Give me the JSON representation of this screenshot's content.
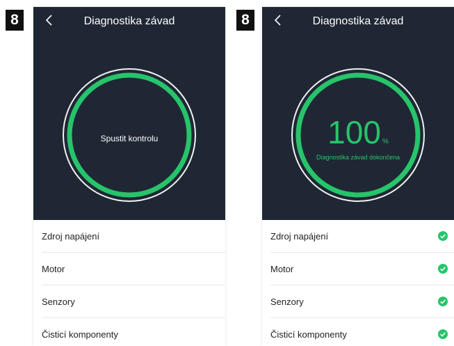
{
  "left": {
    "step": "8",
    "title": "Diagnostika závad",
    "start_label": "Spustit kontrolu",
    "items": [
      {
        "label": "Zdroj napájení"
      },
      {
        "label": "Motor"
      },
      {
        "label": "Senzory"
      },
      {
        "label": "Čisticí komponenty"
      }
    ]
  },
  "right": {
    "step": "8",
    "title": "Diagnostika závad",
    "progress_value": "100",
    "progress_unit": "%",
    "progress_fraction": 1.0,
    "status_text": "Diagnostika závad dokončena",
    "items": [
      {
        "label": "Zdroj napájení",
        "status": "check-icon"
      },
      {
        "label": "Motor",
        "status": "check-icon"
      },
      {
        "label": "Senzory",
        "status": "check-icon"
      },
      {
        "label": "Čisticí komponenty",
        "status": "check-icon"
      }
    ]
  },
  "colors": {
    "hero_bg": "#1f2734",
    "accent_green": "#27c46b",
    "ring_outer": "#f2f2f2",
    "text_dark": "#222222"
  }
}
